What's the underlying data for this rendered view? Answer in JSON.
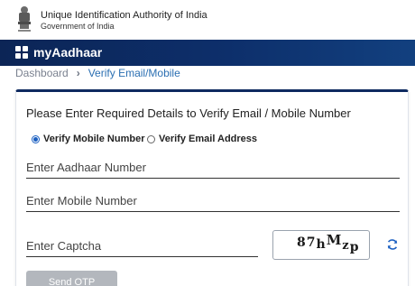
{
  "header": {
    "org_title": "Unique Identification Authority of India",
    "org_subtitle": "Government of India",
    "emblem_icon": "ashoka-emblem-icon"
  },
  "navbar": {
    "brand": "myAadhaar",
    "brand_icon": "grid-apps-icon",
    "background": "#0d2f6b"
  },
  "breadcrumb": {
    "items": [
      "Dashboard",
      "Verify Email/Mobile"
    ],
    "separator": "›",
    "current_color": "#2b6fb2"
  },
  "form": {
    "heading": "Please Enter Required Details to Verify Email / Mobile Number",
    "options": [
      {
        "label": "Verify Mobile Number",
        "selected": true
      },
      {
        "label": "Verify Email Address",
        "selected": false
      }
    ],
    "aadhaar": {
      "placeholder": "Enter Aadhaar Number",
      "value": ""
    },
    "mobile": {
      "placeholder": "Enter Mobile Number",
      "value": ""
    },
    "captcha_input": {
      "placeholder": "Enter Captcha",
      "value": ""
    },
    "captcha_chars": [
      "8",
      "7",
      "h",
      "M",
      "z",
      "p"
    ],
    "refresh_icon": "refresh-icon",
    "send_otp": "Send OTP",
    "accent": "#1a5fc1"
  }
}
